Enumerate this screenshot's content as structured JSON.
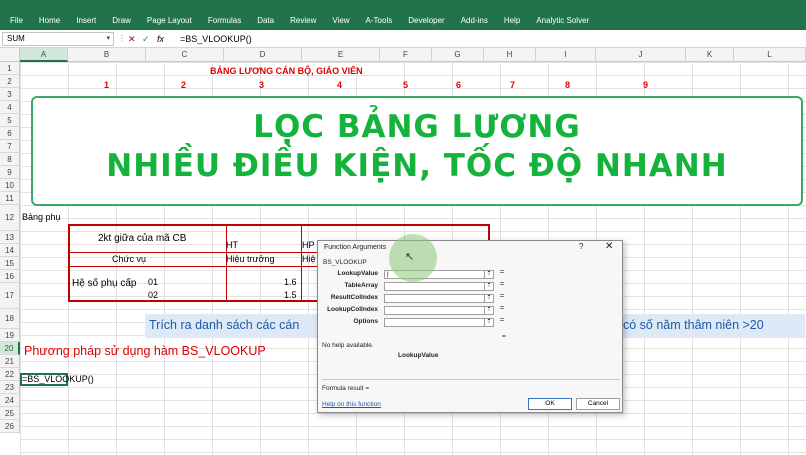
{
  "ribbon": {
    "tabs": [
      "File",
      "Home",
      "Insert",
      "Draw",
      "Page Layout",
      "Formulas",
      "Data",
      "Review",
      "View",
      "A-Tools",
      "Developer",
      "Add-ins",
      "Help",
      "Analytic Solver"
    ]
  },
  "formula_bar": {
    "name_box": "SUM",
    "cancel_icon": "✕",
    "enter_icon": "✓",
    "fx_label": "fx",
    "formula": "=BS_VLOOKUP()"
  },
  "columns": [
    "A",
    "B",
    "C",
    "D",
    "E",
    "F",
    "G",
    "H",
    "I",
    "J",
    "K",
    "L"
  ],
  "rows": [
    "1",
    "2",
    "3",
    "4",
    "5",
    "6",
    "7",
    "8",
    "9",
    "10",
    "11",
    "12",
    "13",
    "14",
    "15",
    "16",
    "17",
    "18",
    "19",
    "20",
    "21",
    "22",
    "23",
    "24",
    "25",
    "26"
  ],
  "sheet": {
    "title_row1": "BẢNG LƯƠNG CÁN BỘ, GIÁO VIÊN",
    "row2_numbers": [
      "1",
      "2",
      "3",
      "4",
      "5",
      "6",
      "7",
      "8",
      "9"
    ],
    "b11": "Bảng phụ",
    "table": {
      "b12": "2kt giữa của mã CB",
      "d12": "HT",
      "e12": "HP",
      "b13": "Chức vụ",
      "d13": "Hiệu trưởng",
      "e13": "Hiệ",
      "b14": "Hệ số phụ cấp",
      "c14": "01",
      "c15": "02",
      "d14": "1.6",
      "d15": "1.5"
    },
    "row17_text": "Trích ra danh sách các cán",
    "row17_text_right": "có số năm thâm niên >20",
    "row18_text": "Phương pháp sử dụng hàm BS_VLOOKUP",
    "a20": "=BS_VLOOKUP()"
  },
  "banner": {
    "line1": "LỌC BẢNG LƯƠNG",
    "line2": "NHIỀU ĐIỀU KIỆN, TỐC ĐỘ NHANH"
  },
  "dialog": {
    "title": "Function Arguments",
    "help_icon": "?",
    "close_icon": "✕",
    "function_name": "BS_VLOOKUP",
    "args": [
      {
        "label": "LookupValue",
        "value": "|",
        "eq": "="
      },
      {
        "label": "TableArray",
        "value": "",
        "eq": "="
      },
      {
        "label": "ResultColIndex",
        "value": "",
        "eq": "="
      },
      {
        "label": "LookupColIndex",
        "value": "",
        "eq": "="
      },
      {
        "label": "Options",
        "value": "",
        "eq": "="
      }
    ],
    "result_eq": "=",
    "no_help": "No help available.",
    "current_arg": "LookupValue",
    "formula_result": "Formula result =",
    "help_link": "Help on this function",
    "ok": "OK",
    "cancel": "Cancel"
  }
}
